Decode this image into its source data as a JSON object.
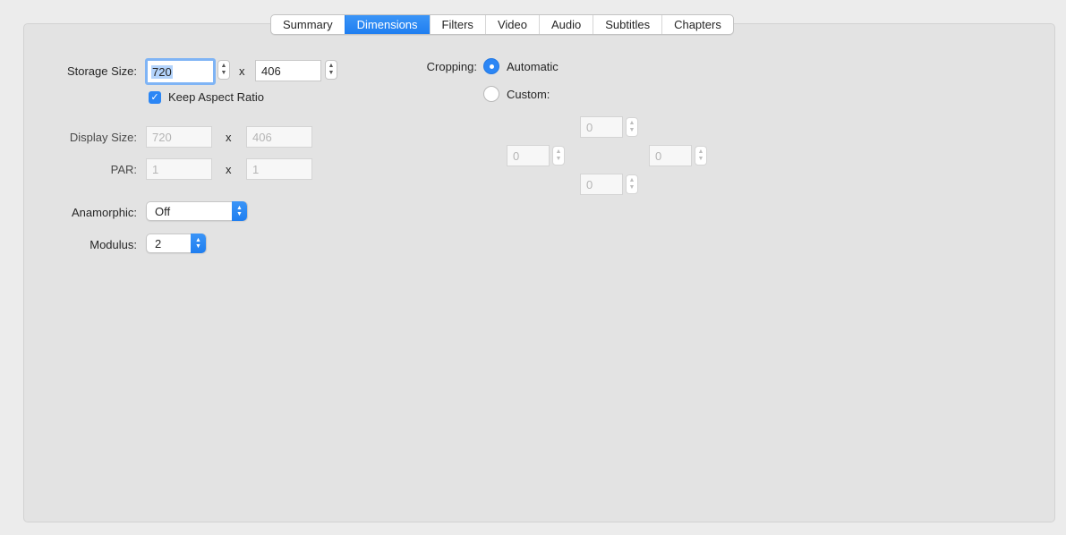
{
  "tabs": [
    {
      "label": "Summary",
      "active": false
    },
    {
      "label": "Dimensions",
      "active": true
    },
    {
      "label": "Filters",
      "active": false
    },
    {
      "label": "Video",
      "active": false
    },
    {
      "label": "Audio",
      "active": false
    },
    {
      "label": "Subtitles",
      "active": false
    },
    {
      "label": "Chapters",
      "active": false
    }
  ],
  "storage": {
    "label": "Storage Size:",
    "width": "720",
    "height": "406",
    "separator": "x",
    "keep_aspect_label": "Keep Aspect Ratio",
    "keep_aspect_checked": true
  },
  "display": {
    "label": "Display Size:",
    "width": "720",
    "height": "406",
    "separator": "x"
  },
  "par": {
    "label": "PAR:",
    "width": "1",
    "height": "1",
    "separator": "x"
  },
  "anamorphic": {
    "label": "Anamorphic:",
    "value": "Off"
  },
  "modulus": {
    "label": "Modulus:",
    "value": "2"
  },
  "cropping": {
    "label": "Cropping:",
    "automatic_label": "Automatic",
    "custom_label": "Custom:",
    "selected": "Automatic",
    "top": "0",
    "left": "0",
    "right": "0",
    "bottom": "0"
  },
  "colors": {
    "accent": "#2b86f5",
    "panel_bg": "#e3e3e3",
    "window_bg": "#ececec"
  }
}
